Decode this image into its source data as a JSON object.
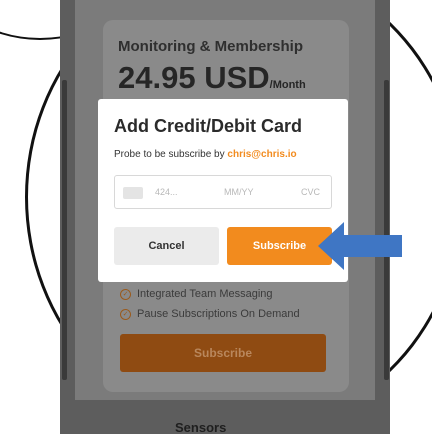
{
  "plan": {
    "name": "Monitoring & Membership",
    "price": "24.95 USD",
    "unit": "/Month"
  },
  "modal": {
    "title": "Add Credit/Debit Card",
    "subtitle_prefix": "Probe to be subscribe by ",
    "email": "chris@chris.io",
    "card_number_placeholder": "424...",
    "expiry_placeholder": "MM/YY",
    "cvc_placeholder": "CVC",
    "cancel_label": "Cancel",
    "subscribe_label": "Subscribe"
  },
  "features": [
    {
      "label": "Integrated Team Messaging",
      "icon": "check-circle-icon"
    },
    {
      "label": "Pause Subscriptions On Demand",
      "icon": "check-circle-icon"
    }
  ],
  "background_subscribe_label": "Subscribe",
  "footer_text": "Sensors",
  "colors": {
    "accent": "#f28b1e",
    "arrow": "#3f76c4",
    "overlay_button": "#8f4b12"
  }
}
